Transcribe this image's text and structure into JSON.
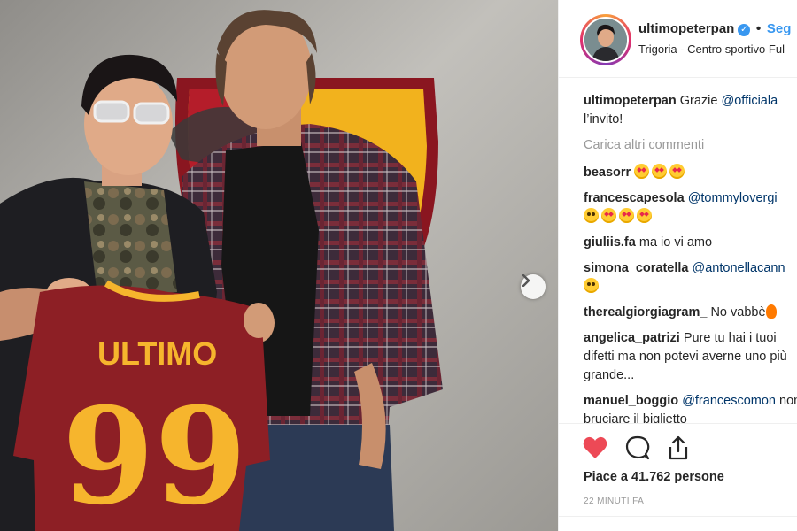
{
  "post": {
    "username": "ultimopeterpan",
    "follow_label": "Seg",
    "separator": "•",
    "verified_glyph": "✓",
    "location": "Trigoria - Centro sportivo Ful"
  },
  "photo": {
    "jersey_name": "ULTIMO",
    "jersey_number": "99",
    "jersey_color": "#8d1f25",
    "jersey_text_color": "#f6b52d"
  },
  "caption": {
    "user": "ultimopeterpan",
    "text_before": "Grazie",
    "mention": "@officiala",
    "text_after": "l’invito!"
  },
  "load_more_label": "Carica altri commenti",
  "comments": [
    {
      "user": "beasorr",
      "text": "",
      "mention": "",
      "emojis": [
        "heart-eyes",
        "heart-eyes",
        "heart-eyes"
      ]
    },
    {
      "user": "francescapesola",
      "text": "",
      "mention": "@tommylovergi",
      "emojis": [
        "scream",
        "heart-eyes",
        "heart-eyes",
        "heart-eyes"
      ]
    },
    {
      "user": "giuliis.fa",
      "text": "ma io vi amo",
      "mention": "",
      "emojis": []
    },
    {
      "user": "simona_coratella",
      "text": "",
      "mention": "@antonellacann",
      "emojis": [
        "smile"
      ]
    },
    {
      "user": "therealgiorgiagram_",
      "text": "No vabbè",
      "mention": "",
      "emojis": [
        "fire"
      ]
    },
    {
      "user": "angelica_patrizi",
      "text": "Pure tu hai i tuoi difetti ma non potevi averne uno più grande...",
      "mention": "",
      "emojis": []
    },
    {
      "user": "manuel_boggio",
      "text": "non bruciare il biglietto",
      "mention": "@francescomon",
      "emojis": []
    }
  ],
  "likes": {
    "prefix": "Piace a",
    "count": "41.762",
    "suffix": "persone"
  },
  "timestamp": "22 MINUTI FA",
  "icons": [
    "heart-icon",
    "comment-icon",
    "share-icon",
    "chevron-right-icon",
    "verified-icon"
  ],
  "colors": {
    "link_blue": "#3897f0",
    "mention_blue": "#003569",
    "like_red": "#ed4956",
    "muted_grey": "#999999"
  }
}
